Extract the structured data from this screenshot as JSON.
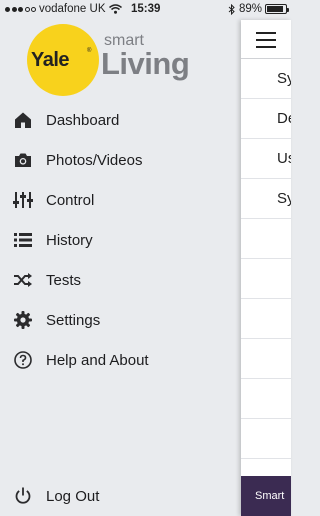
{
  "status_bar": {
    "carrier": "vodafone UK",
    "time": "15:39",
    "battery_text": "89%",
    "battery_level": 0.89
  },
  "logo": {
    "brand": "Yale",
    "registered": "®",
    "smart": "smart",
    "living": "Living"
  },
  "menu": {
    "items": [
      {
        "label": "Dashboard",
        "icon": "home-icon"
      },
      {
        "label": "Photos/Videos",
        "icon": "camera-icon"
      },
      {
        "label": "Control",
        "icon": "sliders-icon"
      },
      {
        "label": "History",
        "icon": "list-icon"
      },
      {
        "label": "Tests",
        "icon": "shuffle-icon"
      },
      {
        "label": "Settings",
        "icon": "gear-icon"
      },
      {
        "label": "Help and About",
        "icon": "question-icon"
      }
    ],
    "logout": {
      "label": "Log Out",
      "icon": "power-icon"
    }
  },
  "panel": {
    "rows": [
      "Sy",
      "De",
      "Us",
      "Sy"
    ],
    "footer": "Smart"
  },
  "colors": {
    "background": "#e9ebee",
    "yale_yellow": "#f8d21c",
    "brand_gray": "#7d7f84",
    "footer_purple": "#3b2b52"
  }
}
